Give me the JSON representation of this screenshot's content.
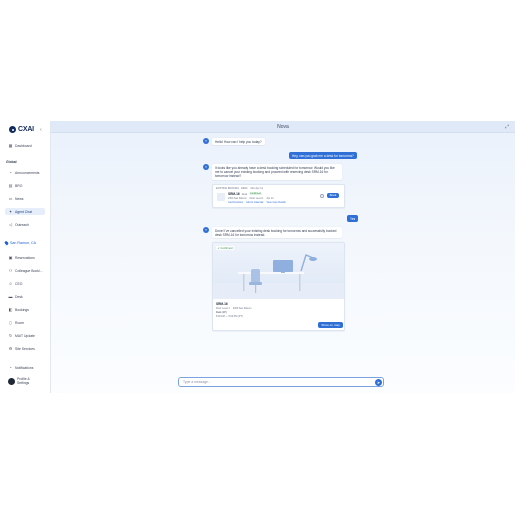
{
  "app": {
    "logo": "CXAI",
    "title": "Nova"
  },
  "sidebar": {
    "items_top": [
      {
        "label": "Dashboard",
        "icon": "grid-icon"
      }
    ],
    "section": "Global",
    "global_items": [
      {
        "label": "Announcements",
        "icon": "bell-icon"
      },
      {
        "label": "BRO",
        "icon": "chart-icon"
      },
      {
        "label": "News",
        "icon": "news-icon"
      },
      {
        "label": "Agent Chat",
        "icon": "sparkle-icon",
        "active": true
      },
      {
        "label": "Outreach",
        "icon": "megaphone-icon"
      }
    ],
    "location": "San Ramon, CA",
    "location_items": [
      {
        "label": "Reservations",
        "icon": "calendar-icon"
      },
      {
        "label": "Colleague Booki...",
        "icon": "people-icon"
      },
      {
        "label": "CEO",
        "icon": "person-icon"
      },
      {
        "label": "Desk",
        "icon": "desk-icon"
      },
      {
        "label": "Bookings",
        "icon": "bookmark-icon"
      },
      {
        "label": "Room",
        "icon": "door-icon"
      },
      {
        "label": "MAIT Update",
        "icon": "refresh-icon"
      },
      {
        "label": "Site Services",
        "icon": "tools-icon"
      }
    ],
    "notifications": "Notifications",
    "profile": "Profile & Settings"
  },
  "chat": {
    "msg1": "Hello! How can I help you today?",
    "user1": "Hey, can you grab me a desk for tomorrow?",
    "msg2": "It looks like you already have a desk booking scheduled for tomorrow. Would you like me to cancel your existing booking and proceed with reserving desk SRM-16 for tomorrow instead?",
    "booking_card": {
      "header": "EXISTING BOOKING · DESK",
      "date": "Mon Apr 14",
      "desk": "SRM-16",
      "tag": "Desk",
      "status": "Confirmed",
      "meta1": "2300 San Ramon",
      "meta2": "Floor Level 1",
      "meta3": "Apr 14",
      "link1": "Get Directions",
      "link2": "Add to Calendar",
      "link3": "View more Details",
      "action": "Book"
    },
    "user2": "Yes",
    "msg3": "Done! I've cancelled your existing desk booking for tomorrow and successfully booked desk SRM-16 for tomorrow instead.",
    "result_card": {
      "badge": "Confirmed",
      "desk": "SRM-16",
      "meta1": "Floor Level 1",
      "meta2": "2300 San Ramon",
      "type": "Desk (1P)",
      "time": "8:00 AM — 5:00 PM (PT)",
      "button": "Show on map"
    },
    "input_placeholder": "Type a message..."
  },
  "colors": {
    "primary": "#2f6fd6",
    "brand": "#102a5c",
    "success": "#2f8a44"
  }
}
